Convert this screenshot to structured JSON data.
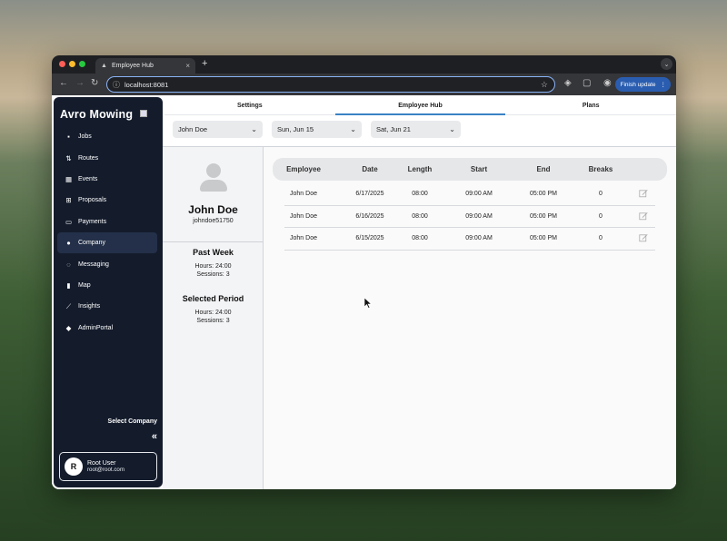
{
  "browser": {
    "tab_title": "Employee Hub",
    "url": "localhost:8081",
    "finish_update_label": "Finish update"
  },
  "sidebar": {
    "brand": "Avro Mowing",
    "items": [
      {
        "label": "Jobs",
        "icon": "briefcase-icon",
        "glyph": "▪"
      },
      {
        "label": "Routes",
        "icon": "routes-icon",
        "glyph": "⇅"
      },
      {
        "label": "Events",
        "icon": "calendar-icon",
        "glyph": "▦"
      },
      {
        "label": "Proposals",
        "icon": "proposal-icon",
        "glyph": "⊞"
      },
      {
        "label": "Payments",
        "icon": "credit-card-icon",
        "glyph": "▭"
      },
      {
        "label": "Company",
        "icon": "company-icon",
        "glyph": "●"
      },
      {
        "label": "Messaging",
        "icon": "chat-icon",
        "glyph": "◌"
      },
      {
        "label": "Map",
        "icon": "map-icon",
        "glyph": "▮"
      },
      {
        "label": "Insights",
        "icon": "insights-icon",
        "glyph": "⟋"
      },
      {
        "label": "AdminPortal",
        "icon": "admin-icon",
        "glyph": "◆"
      }
    ],
    "active_item": "Company",
    "select_company_label": "Select Company",
    "collapse_glyph": "«",
    "user": {
      "initial": "R",
      "name": "Root User",
      "email": "root@root.com"
    }
  },
  "tabs": [
    {
      "label": "Settings"
    },
    {
      "label": "Employee Hub"
    },
    {
      "label": "Plans"
    }
  ],
  "active_tab": "Employee Hub",
  "filters": {
    "employee": "John Doe",
    "start_date": "Sun, Jun 15",
    "end_date": "Sat, Jun 21"
  },
  "profile": {
    "name": "John Doe",
    "username": "johndoe51750",
    "past_week": {
      "title": "Past Week",
      "hours": "Hours: 24:00",
      "sessions": "Sessions: 3"
    },
    "selected_period": {
      "title": "Selected Period",
      "hours": "Hours: 24:00",
      "sessions": "Sessions: 3"
    }
  },
  "table": {
    "columns": [
      "Employee",
      "Date",
      "Length",
      "Start",
      "End",
      "Breaks"
    ],
    "rows": [
      [
        "John Doe",
        "6/17/2025",
        "08:00",
        "09:00 AM",
        "05:00 PM",
        "0"
      ],
      [
        "John Doe",
        "6/16/2025",
        "08:00",
        "09:00 AM",
        "05:00 PM",
        "0"
      ],
      [
        "John Doe",
        "6/15/2025",
        "08:00",
        "09:00 AM",
        "05:00 PM",
        "0"
      ]
    ]
  },
  "colors": {
    "sidebar_bg": "#141c2c",
    "accent": "#3b82c4",
    "update_button": "#2a5db0"
  }
}
